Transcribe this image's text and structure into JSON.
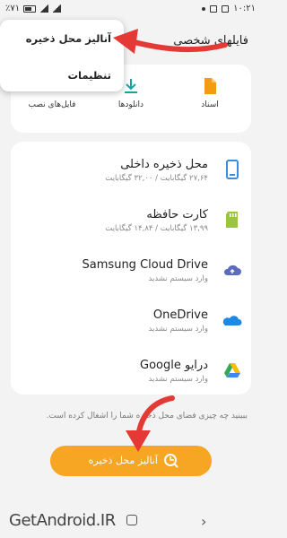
{
  "status_bar": {
    "time": "۱۰:۲۱",
    "left_text": "٪۷۱"
  },
  "header": {
    "title": "فایلهای شخصی"
  },
  "menu": {
    "items": [
      "آنالیز محل ذخیره",
      "تنظیمات"
    ]
  },
  "categories": [
    {
      "label": "اسناد",
      "icon": "document-icon",
      "color": "#f39c12"
    },
    {
      "label": "دانلودها",
      "icon": "download-icon",
      "color": "#1aa3a3"
    },
    {
      "label": "فایل‌های نصب",
      "icon": "apk-icon",
      "color": "#e74c3c"
    }
  ],
  "storage": [
    {
      "title": "محل ذخیره داخلی",
      "sub": "۲۷,۶۴ گیگابایت / ۳۲,۰۰ گیگابایت",
      "icon": "phone-icon",
      "color": "#3a8dde"
    },
    {
      "title": "کارت حافظه",
      "sub": "۱۳,۹۹ گیگابایت / ۱۴,۸۴ گیگابایت",
      "icon": "sd-card-icon",
      "color": "#9bc53d"
    },
    {
      "title": "Samsung Cloud Drive",
      "sub": "وارد سیستم نشدید",
      "icon": "samsung-cloud-icon",
      "color": "#5c6bc0"
    },
    {
      "title": "OneDrive",
      "sub": "وارد سیستم نشدید",
      "icon": "onedrive-icon",
      "color": "#1e88e5"
    },
    {
      "title": "درایو Google",
      "sub": "وارد سیستم نشدید",
      "icon": "google-drive-icon",
      "color": "#34a853"
    }
  ],
  "description": "ببینید چه چیزی فضای محل ذخیره شما را اشغال کرده است.",
  "analyze_button": {
    "label": "آنالیز محل ذخیره",
    "color": "#f6a623"
  },
  "watermark": "GetAndroid.IR",
  "accent": "#e53935"
}
